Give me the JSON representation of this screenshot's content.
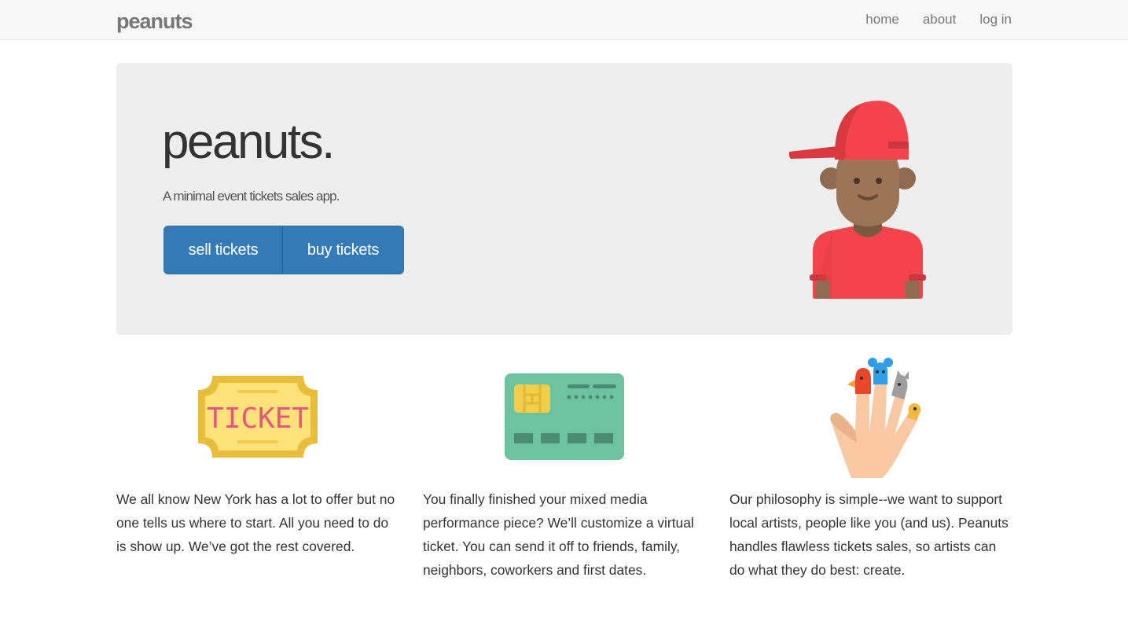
{
  "navbar": {
    "brand": "peanuts",
    "links": [
      "home",
      "about",
      "log in"
    ]
  },
  "hero": {
    "title": "peanuts.",
    "subtitle": "A minimal event tickets sales app.",
    "sell_label": "sell tickets",
    "buy_label": "buy tickets",
    "avatar_icon": "person-red-cap-icon"
  },
  "features": [
    {
      "icon": "ticket-icon",
      "ticket_text": "TICKET",
      "text": "We all know New York has a lot to offer but no one tells us where to start. All you need to do is show up. We’ve got the rest covered."
    },
    {
      "icon": "credit-card-icon",
      "text": "You finally finished your mixed media performance piece? We’ll customize a virtual ticket. You can send it off to friends, family, neighbors, coworkers and first dates."
    },
    {
      "icon": "finger-puppets-hand-icon",
      "text": "Our philosophy is simple--we want to support local artists, people like you (and us). Peanuts handles flawless tickets sales, so artists can do what they do best: create."
    }
  ],
  "colors": {
    "primary": "#337ab7",
    "jumbotron": "#eeeeee",
    "navbar": "#f8f8f8",
    "accent_red": "#f2444a"
  }
}
